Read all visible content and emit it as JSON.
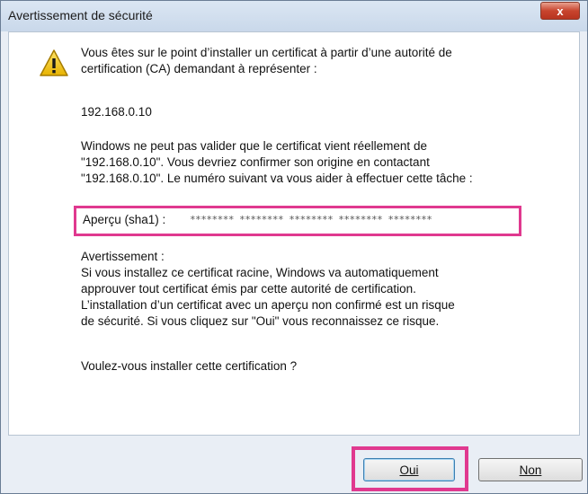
{
  "window": {
    "title": "Avertissement de sécurité",
    "close_label": "x"
  },
  "message": {
    "intro_lines": "Vous êtes sur le point d’installer un certificat à partir d’une autorité de\ncertification (CA) demandant à représenter :",
    "host": "192.168.0.10",
    "validation_lines": "Windows ne peut pas valider que le certificat vient réellement de\n\"192.168.0.10\". Vous devriez confirmer son origine en contactant\n\"192.168.0.10\". Le numéro suivant va vous aider à effectuer cette tâche :",
    "fingerprint_label": "Aperçu (sha1) :",
    "fingerprint_value": "******** ******** ******** ******** ********",
    "warning_lines": "Avertissement :\nSi vous installez ce certificat racine, Windows va automatiquement\napprouver tout certificat émis par cette autorité de certification.\nL’installation d’un certificat avec un aperçu non confirmé est un risque\nde sécurité. Si vous cliquez sur \"Oui\" vous reconnaissez ce risque.",
    "question": "Voulez-vous installer cette certification ?"
  },
  "buttons": {
    "yes_label": "Oui",
    "no_label": "Non"
  },
  "colors": {
    "highlight": "#e0398f",
    "warning_icon": "#f2c200"
  }
}
